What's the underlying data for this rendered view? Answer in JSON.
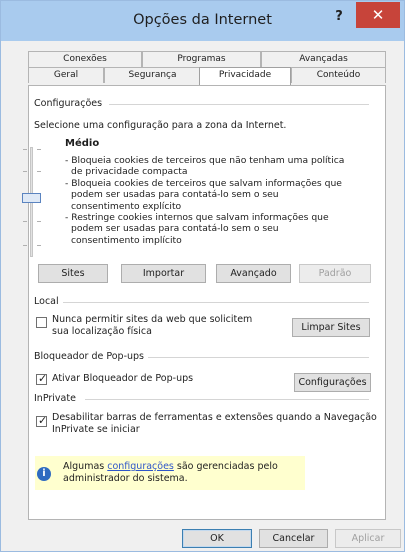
{
  "window": {
    "title": "Opções da Internet",
    "help": "?",
    "close": "✕"
  },
  "tabs": {
    "row1": [
      "Conexões",
      "Programas",
      "Avançadas"
    ],
    "row2": [
      "Geral",
      "Segurança",
      "Privacidade",
      "Conteúdo"
    ],
    "active": "Privacidade"
  },
  "config": {
    "heading": "Configurações",
    "instruction": "Selecione uma configuração para a zona da Internet.",
    "level": "Médio",
    "slider_level_fraction": 0.5,
    "description": [
      "- Bloqueia cookies de terceiros que não tenham uma política",
      "  de privacidade compacta",
      "- Bloqueia cookies de terceiros que salvam informações que",
      "  podem ser usadas para contatá-lo sem o seu",
      "  consentimento explícito",
      "- Restringe cookies internos que salvam informações que",
      "  podem ser usadas para contatá-lo sem o seu",
      "  consentimento implícito"
    ],
    "buttons": {
      "sites": "Sites",
      "import": "Importar",
      "advanced": "Avançado",
      "default": "Padrão"
    }
  },
  "local": {
    "heading": "Local",
    "checkbox_line1": "Nunca permitir sites da web que solicitem",
    "checkbox_line2": "sua localização física",
    "checked": false,
    "clear_button": "Limpar Sites"
  },
  "popup": {
    "heading": "Bloqueador de Pop-ups",
    "checkbox_label": "Ativar Bloqueador de Pop-ups",
    "checked": true,
    "settings_button": "Configurações"
  },
  "inprivate": {
    "heading": "InPrivate",
    "checkbox_line1": "Desabilitar barras de ferramentas e extensões quando a Navegação",
    "checkbox_line2": "InPrivate se iniciar",
    "checked": true
  },
  "info": {
    "prefix": "Algumas ",
    "link": "configurações",
    "suffix": " são gerenciadas pelo",
    "line2": "administrador do sistema."
  },
  "footer": {
    "ok": "OK",
    "cancel": "Cancelar",
    "apply": "Aplicar"
  },
  "colors": {
    "titlebar": "#a9cbee",
    "close": "#c7443a",
    "info_bg": "#ffffcf",
    "link": "#2f56c9"
  }
}
